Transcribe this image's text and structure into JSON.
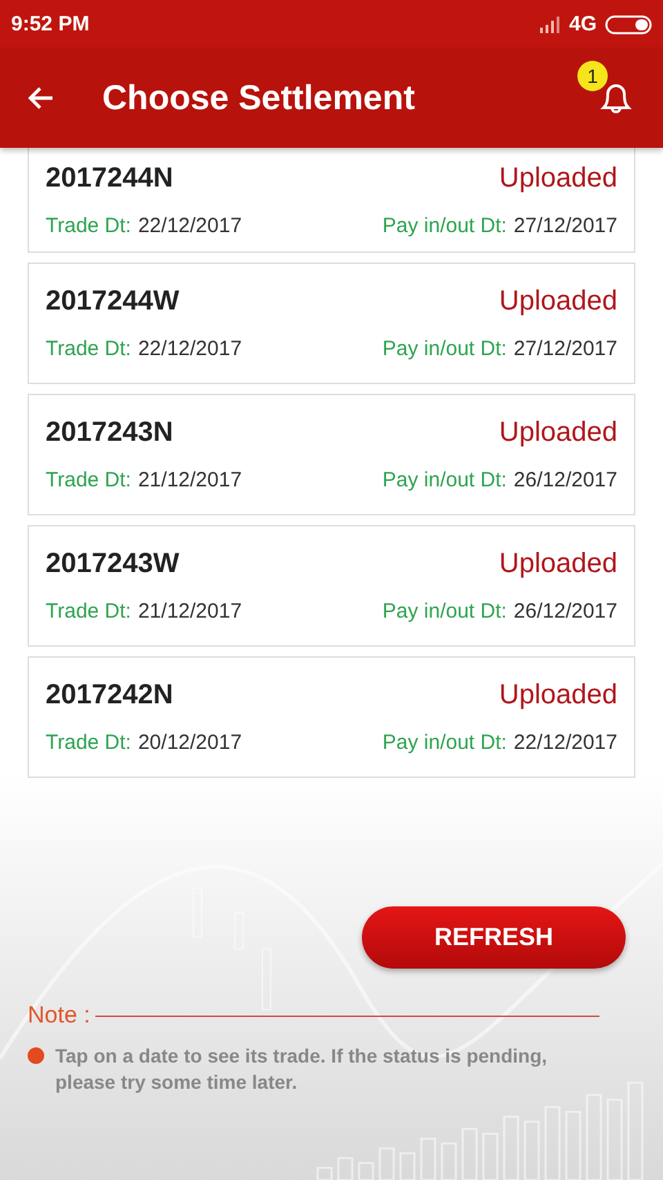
{
  "status_bar": {
    "time": "9:52 PM",
    "network": "4G"
  },
  "app_bar": {
    "title": "Choose Settlement",
    "notification_count": "1"
  },
  "settlements": [
    {
      "id": "2017244N",
      "status": "Uploaded",
      "trade_label": "Trade Dt:",
      "trade_date": "22/12/2017",
      "pay_label": "Pay in/out Dt:",
      "pay_date": "27/12/2017"
    },
    {
      "id": "2017244W",
      "status": "Uploaded",
      "trade_label": "Trade Dt:",
      "trade_date": "22/12/2017",
      "pay_label": "Pay in/out Dt:",
      "pay_date": "27/12/2017"
    },
    {
      "id": "2017243N",
      "status": "Uploaded",
      "trade_label": "Trade Dt:",
      "trade_date": "21/12/2017",
      "pay_label": "Pay in/out Dt:",
      "pay_date": "26/12/2017"
    },
    {
      "id": "2017243W",
      "status": "Uploaded",
      "trade_label": "Trade Dt:",
      "trade_date": "21/12/2017",
      "pay_label": "Pay in/out Dt:",
      "pay_date": "26/12/2017"
    },
    {
      "id": "2017242N",
      "status": "Uploaded",
      "trade_label": "Trade Dt:",
      "trade_date": "20/12/2017",
      "pay_label": "Pay in/out Dt:",
      "pay_date": "22/12/2017"
    }
  ],
  "refresh_button": "REFRESH",
  "note": {
    "label": "Note :",
    "text": "Tap on a date to see its trade. If the status is pending, please try some time later."
  }
}
